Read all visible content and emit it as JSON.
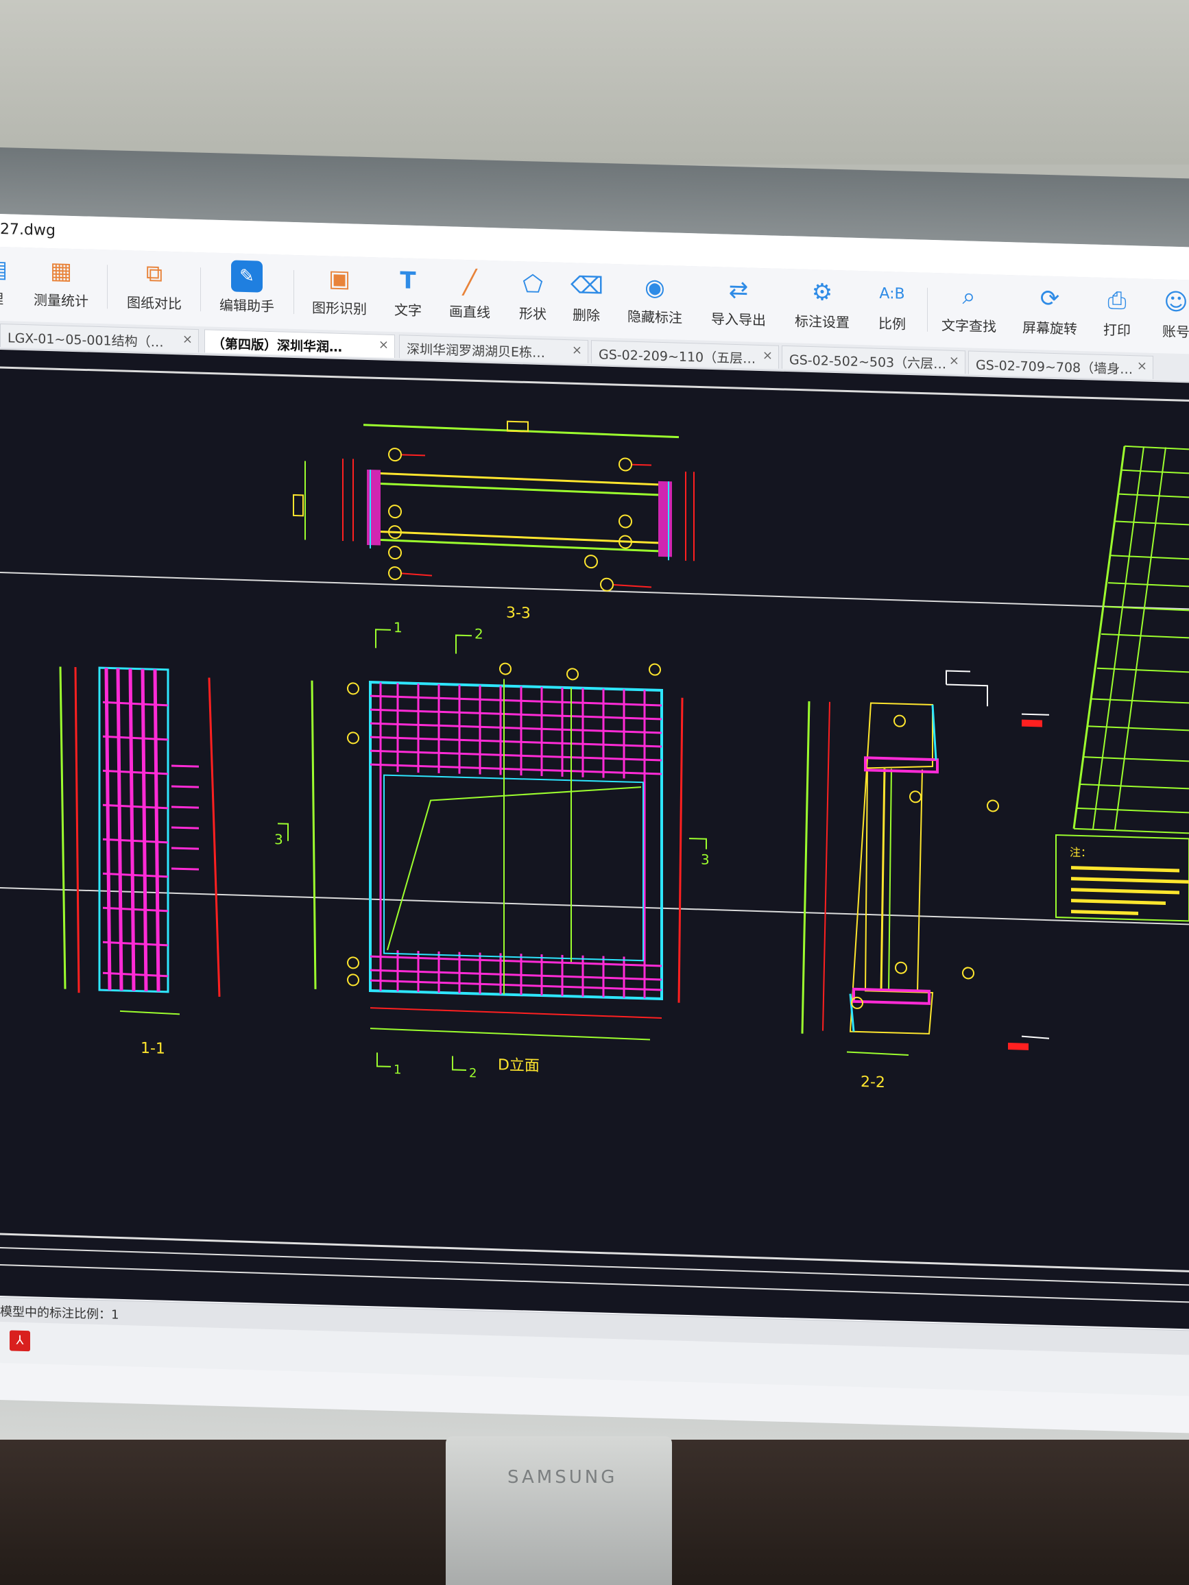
{
  "window": {
    "title": "27.dwg"
  },
  "toolbar": [
    {
      "label": "理",
      "icon": "layers-icon"
    },
    {
      "label": "测量统计",
      "icon": "measure-icon"
    },
    {
      "label": "图纸对比",
      "icon": "compare-icon"
    },
    {
      "label": "编辑助手",
      "icon": "edit-helper-icon"
    },
    {
      "label": "图形识别",
      "icon": "shape-recognize-icon"
    },
    {
      "label": "文字",
      "icon": "text-icon"
    },
    {
      "label": "画直线",
      "icon": "line-icon"
    },
    {
      "label": "形状",
      "icon": "shape-icon"
    },
    {
      "label": "删除",
      "icon": "eraser-icon"
    },
    {
      "label": "隐藏标注",
      "icon": "eye-icon"
    },
    {
      "label": "导入导出",
      "icon": "import-export-icon"
    },
    {
      "label": "标注设置",
      "icon": "annotation-settings-icon"
    },
    {
      "label": "比例",
      "icon": "scale-icon"
    },
    {
      "label": "文字查找",
      "icon": "text-search-icon"
    },
    {
      "label": "屏幕旋转",
      "icon": "rotate-screen-icon"
    },
    {
      "label": "打印",
      "icon": "printer-icon"
    },
    {
      "label": "账号",
      "icon": "account-icon"
    }
  ],
  "tabs": [
    {
      "label": "LGX-01~05-001结构（…",
      "active": false
    },
    {
      "label": "（第四版）深圳华润…",
      "active": true
    },
    {
      "label": "深圳华润罗湖湖贝E栋…",
      "active": false
    },
    {
      "label": "GS-02-209~110（五层…",
      "active": false
    },
    {
      "label": "GS-02-502~503（六层…",
      "active": false
    },
    {
      "label": "GS-02-709~708（墙身…",
      "active": false
    }
  ],
  "drawing": {
    "section_33": "3-3",
    "section_11": "1-1",
    "section_22": "2-2",
    "elevation": "D立面",
    "marks": [
      "1",
      "2",
      "3"
    ],
    "notes_header": "注："
  },
  "status": {
    "text": "模型中的标注比例：1"
  },
  "colors": {
    "canvas": "#141520",
    "rebar": "#ff2bd6",
    "dim": "#9dff2e",
    "outline": "#2ee6ff",
    "red": "#ff2020",
    "yellow": "#ffe62e"
  }
}
